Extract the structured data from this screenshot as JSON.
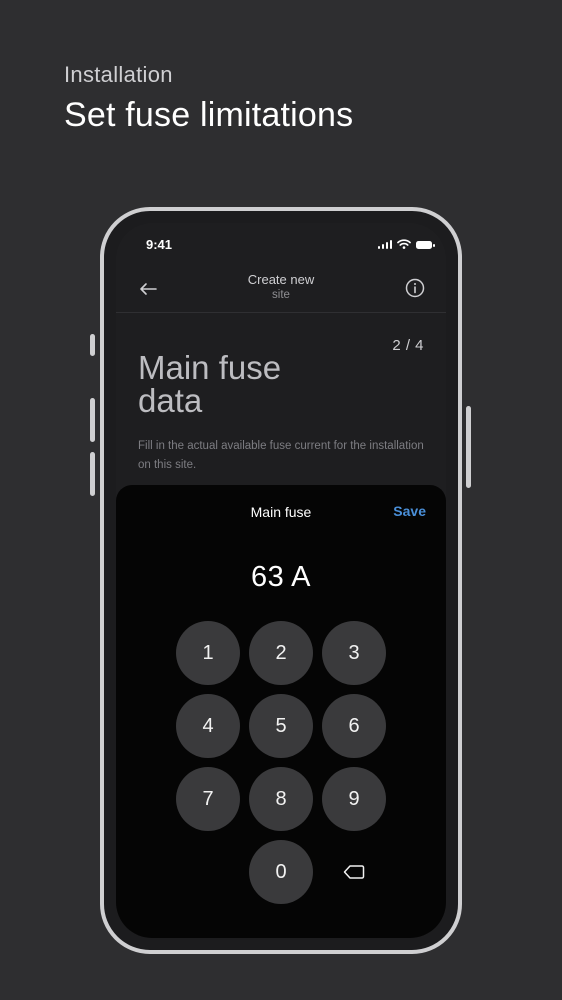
{
  "hero": {
    "eyebrow": "Installation",
    "title": "Set fuse limitations"
  },
  "status_bar": {
    "time": "9:41",
    "icons": [
      "signal-icon",
      "wifi-icon",
      "battery-icon"
    ]
  },
  "nav": {
    "title_line1": "Create new",
    "title_line2": "site",
    "back_icon": "back-arrow-icon",
    "info_icon": "info-icon"
  },
  "page": {
    "step": "2 / 4",
    "heading_line1": "Main fuse",
    "heading_line2": "data",
    "description": "Fill in the actual available fuse current for the installation on this site."
  },
  "sheet": {
    "title": "Main fuse",
    "save_label": "Save",
    "save_color": "#4a8fd8",
    "value": "63 A"
  },
  "keypad": {
    "keys": [
      "1",
      "2",
      "3",
      "4",
      "5",
      "6",
      "7",
      "8",
      "9",
      "0"
    ],
    "backspace_icon": "backspace-icon"
  },
  "colors": {
    "background": "#2e2e30",
    "screen": "#1e1e20",
    "sheet": "#050505",
    "key": "#3a3a3c"
  }
}
